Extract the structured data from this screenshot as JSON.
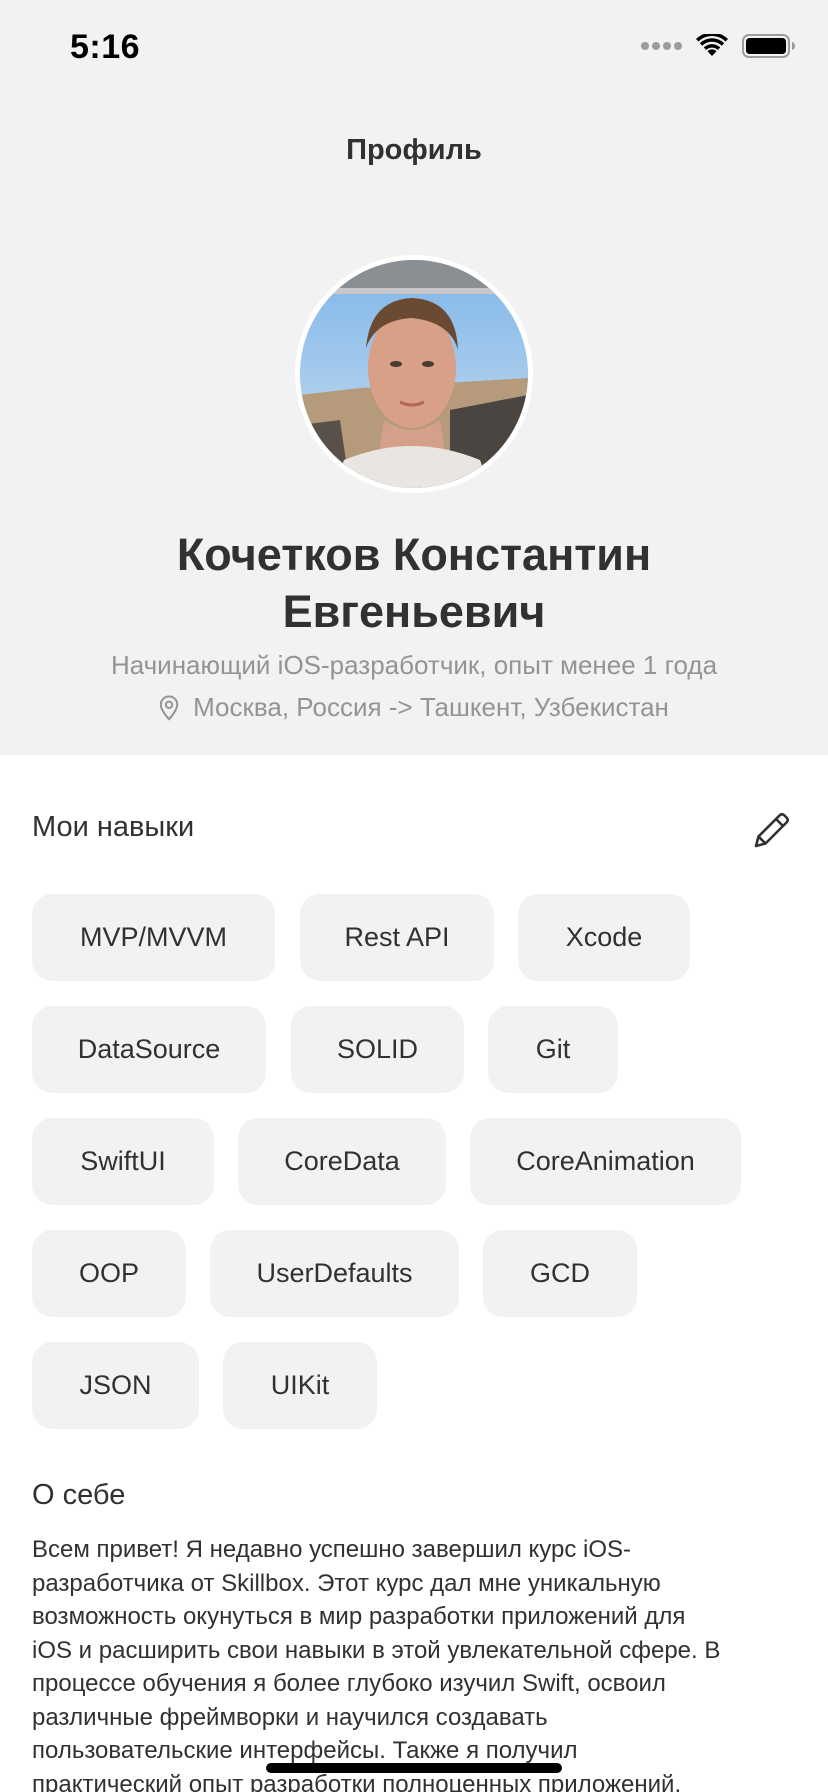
{
  "status_bar": {
    "time": "5:16"
  },
  "nav": {
    "title": "Профиль"
  },
  "profile": {
    "name_line1": "Кочетков Константин",
    "name_line2": "Евгеньевич",
    "role": "Начинающий iOS-разработчик, опыт менее 1 года",
    "location": "Москва, Россия -> Ташкент, Узбекистан",
    "location_icon": "map-pin-icon"
  },
  "skills": {
    "title": "Мои навыки",
    "edit_icon": "pencil-icon",
    "items": [
      "MVP/MVVM",
      "Rest API",
      "Xcode",
      "DataSource",
      "SOLID",
      "Git",
      "SwiftUI",
      "CoreData",
      "CoreAnimation",
      "OOP",
      "UserDefaults",
      "GCD",
      "JSON",
      "UIKit"
    ]
  },
  "about": {
    "title": "О себе",
    "lines": [
      "Всем привет! Я недавно успешно завершил курс iOS-",
      "разработчика от Skillbox. Этот курс дал мне уникальную",
      "возможность окунуться в мир разработки приложений для",
      "iOS и расширить свои навыки в этой увлекательной сфере. В",
      "процессе обучения я более глубоко изучил Swift, освоил",
      "различные фреймворки и научился создавать",
      "пользовательские интерфейсы. Также я получил",
      "практический опыт разработки полноценных приложений,"
    ]
  },
  "colors": {
    "background": "#ffffff",
    "header_background": "#f2f2f3",
    "chip_background": "#f2f2f3",
    "text": "#313131",
    "secondary_text": "#949496"
  }
}
